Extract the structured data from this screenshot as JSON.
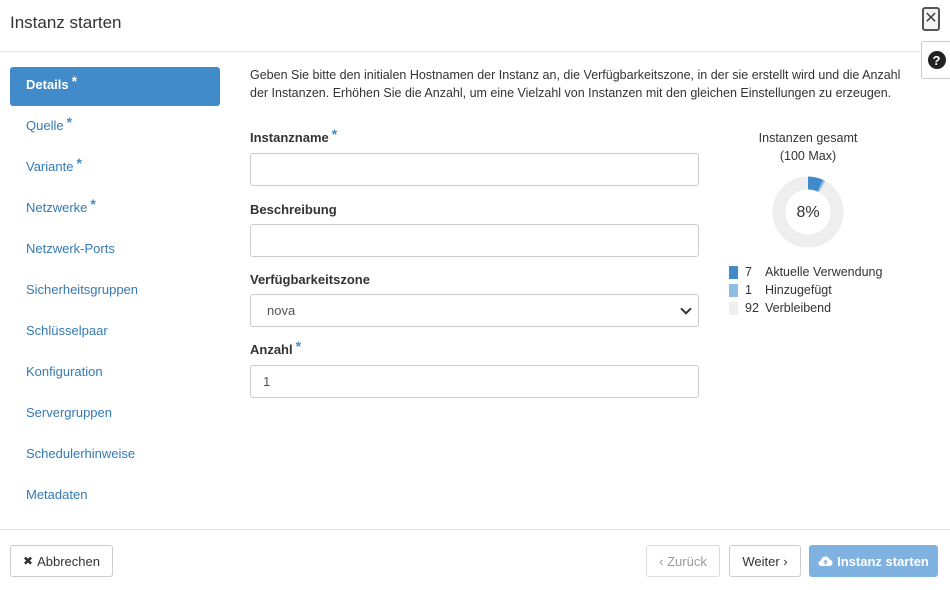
{
  "header": {
    "title": "Instanz starten"
  },
  "sidebar": {
    "items": [
      {
        "label": "Details",
        "required": "*"
      },
      {
        "label": "Quelle",
        "required": "*"
      },
      {
        "label": "Variante",
        "required": "*"
      },
      {
        "label": "Netzwerke",
        "required": "*"
      },
      {
        "label": "Netzwerk-Ports"
      },
      {
        "label": "Sicherheitsgruppen"
      },
      {
        "label": "Schlüsselpaar"
      },
      {
        "label": "Konfiguration"
      },
      {
        "label": "Servergruppen"
      },
      {
        "label": "Schedulerhinweise"
      },
      {
        "label": "Metadaten"
      }
    ]
  },
  "main": {
    "intro": "Geben Sie bitte den initialen Hostnamen der Instanz an, die Verfügbarkeitszone, in der sie erstellt wird und die Anzahl der Instanzen. Erhöhen Sie die Anzahl, um eine Vielzahl von Instanzen mit den gleichen Einstellungen zu erzeugen.",
    "instance_name": {
      "label": "Instanzname",
      "required": "*",
      "value": ""
    },
    "description": {
      "label": "Beschreibung",
      "value": ""
    },
    "availability_zone": {
      "label": "Verfügbarkeitszone",
      "value": "nova"
    },
    "count": {
      "label": "Anzahl",
      "required": "*",
      "value": "1"
    }
  },
  "stats": {
    "title": "Instanzen gesamt",
    "subtitle": "(100 Max)",
    "percent_label": "8%",
    "used": 7,
    "added": 1,
    "remaining": 92,
    "max": 100,
    "legend": [
      {
        "value": "7",
        "label": "Aktuelle Verwendung",
        "color": "#428bca"
      },
      {
        "value": "1",
        "label": "Hinzugefügt",
        "color": "#8fbde6"
      },
      {
        "value": "92",
        "label": "Verbleibend",
        "color": "#eeeeee"
      }
    ]
  },
  "footer": {
    "cancel_icon": "✖",
    "cancel_label": "Abbrechen",
    "back_label": "‹ Zurück",
    "next_label": "Weiter ›",
    "launch_label": "Instanz starten"
  },
  "colors": {
    "accent": "#428bca",
    "link": "#337ab7",
    "primary_disabled": "#7fb2e0"
  }
}
